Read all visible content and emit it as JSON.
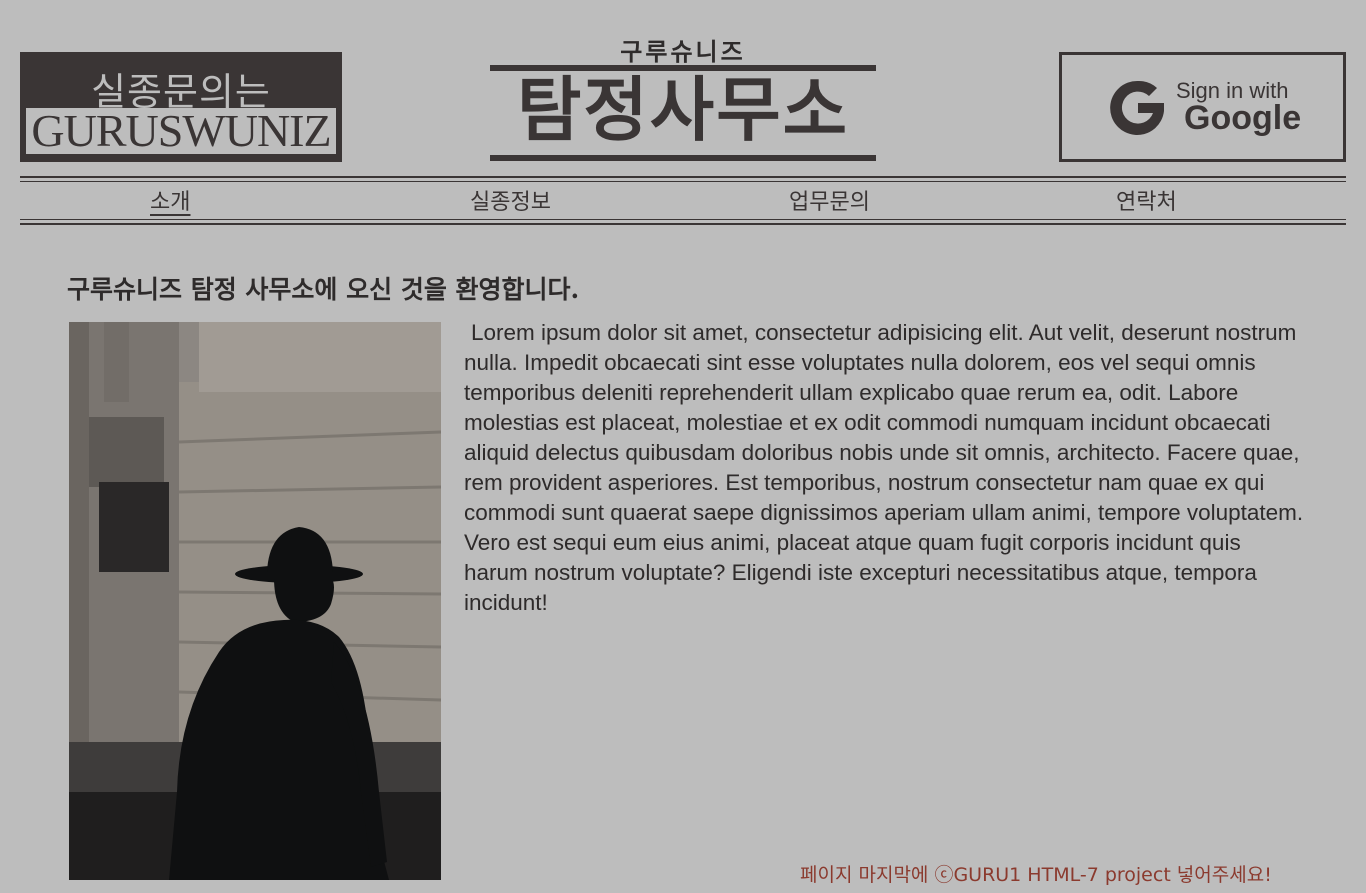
{
  "header": {
    "logo_top": "실종문의는",
    "logo_bottom": "GURUSWUNIZ",
    "masthead_sub": "구루슈니즈",
    "masthead_title": "탐정사무소",
    "signin": {
      "line1": "Sign in with",
      "line2": "Google",
      "icon": "google-g-icon"
    }
  },
  "nav": {
    "items": [
      {
        "label": "소개",
        "active": true
      },
      {
        "label": "실종정보",
        "active": false
      },
      {
        "label": "업무문의",
        "active": false
      },
      {
        "label": "연락처",
        "active": false
      }
    ]
  },
  "main": {
    "welcome": "구루슈니즈 탐정 사무소에 오신 것을 환영합니다.",
    "body": "Lorem ipsum dolor sit amet, consectetur adipisicing elit. Aut velit, deserunt nostrum nulla. Impedit obcaecati sint esse voluptates nulla dolorem, eos vel sequi omnis temporibus deleniti reprehenderit ullam explicabo quae rerum ea, odit. Labore molestias est placeat, molestiae et ex odit commodi numquam incidunt obcaecati aliquid delectus quibusdam doloribus nobis unde sit omnis, architecto. Facere quae, rem provident asperiores. Est temporibus, nostrum consectetur nam quae ex qui commodi sunt quaerat saepe dignissimos aperiam ullam animi, tempore voluptatem. Vero est sequi eum eius animi, placeat atque quam fugit corporis incidunt quis harum nostrum voluptate? Eligendi iste excepturi necessitatibus atque, tempora incidunt!",
    "image": "detective-silhouette-photo"
  },
  "footer": {
    "note": "페이지 마지막에 ⓒGURU1 HTML-7 project 넣어주세요!"
  },
  "colors": {
    "background": "#bdbdbd",
    "ink": "#3a3535",
    "footer_text": "#8b3a2e"
  }
}
